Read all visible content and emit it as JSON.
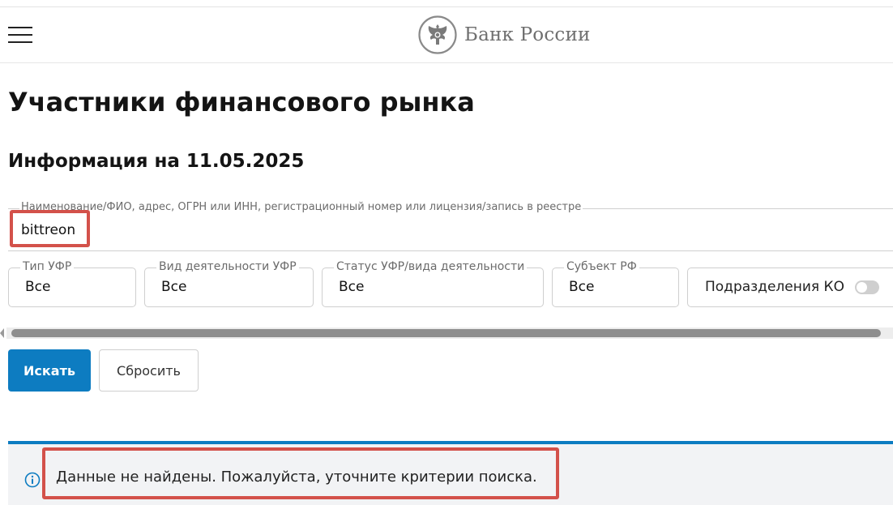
{
  "header": {
    "logo_text": "Банк России",
    "menu_icon": "hamburger-menu-icon",
    "logo_icon": "bank-of-russia-eagle-emblem-icon"
  },
  "page": {
    "title": "Участники финансового рынка",
    "info_date": "Информация на 11.05.2025"
  },
  "search": {
    "label": "Наименование/ФИО, адрес, ОГРН или ИНН, регистрационный номер или лицензия/запись в реестре",
    "value": "bittreon"
  },
  "filters": {
    "type": {
      "label": "Тип УФР",
      "value": "Все"
    },
    "activity": {
      "label": "Вид деятельности УФР",
      "value": "Все"
    },
    "status": {
      "label": "Статус УФР/вида деятельности",
      "value": "Все"
    },
    "subject": {
      "label": "Субъект РФ",
      "value": "Все"
    },
    "ko_divisions": {
      "label": "Подразделения КО",
      "enabled": false
    }
  },
  "buttons": {
    "search_label": "Искать",
    "reset_label": "Сбросить"
  },
  "notice": {
    "icon": "info-icon",
    "text": "Данные не найдены. Пожалуйста, уточните критерии поиска."
  },
  "colors": {
    "accent": "#0d7cc1",
    "highlight": "#d3514a",
    "notice_bg": "#f2f3f5"
  }
}
